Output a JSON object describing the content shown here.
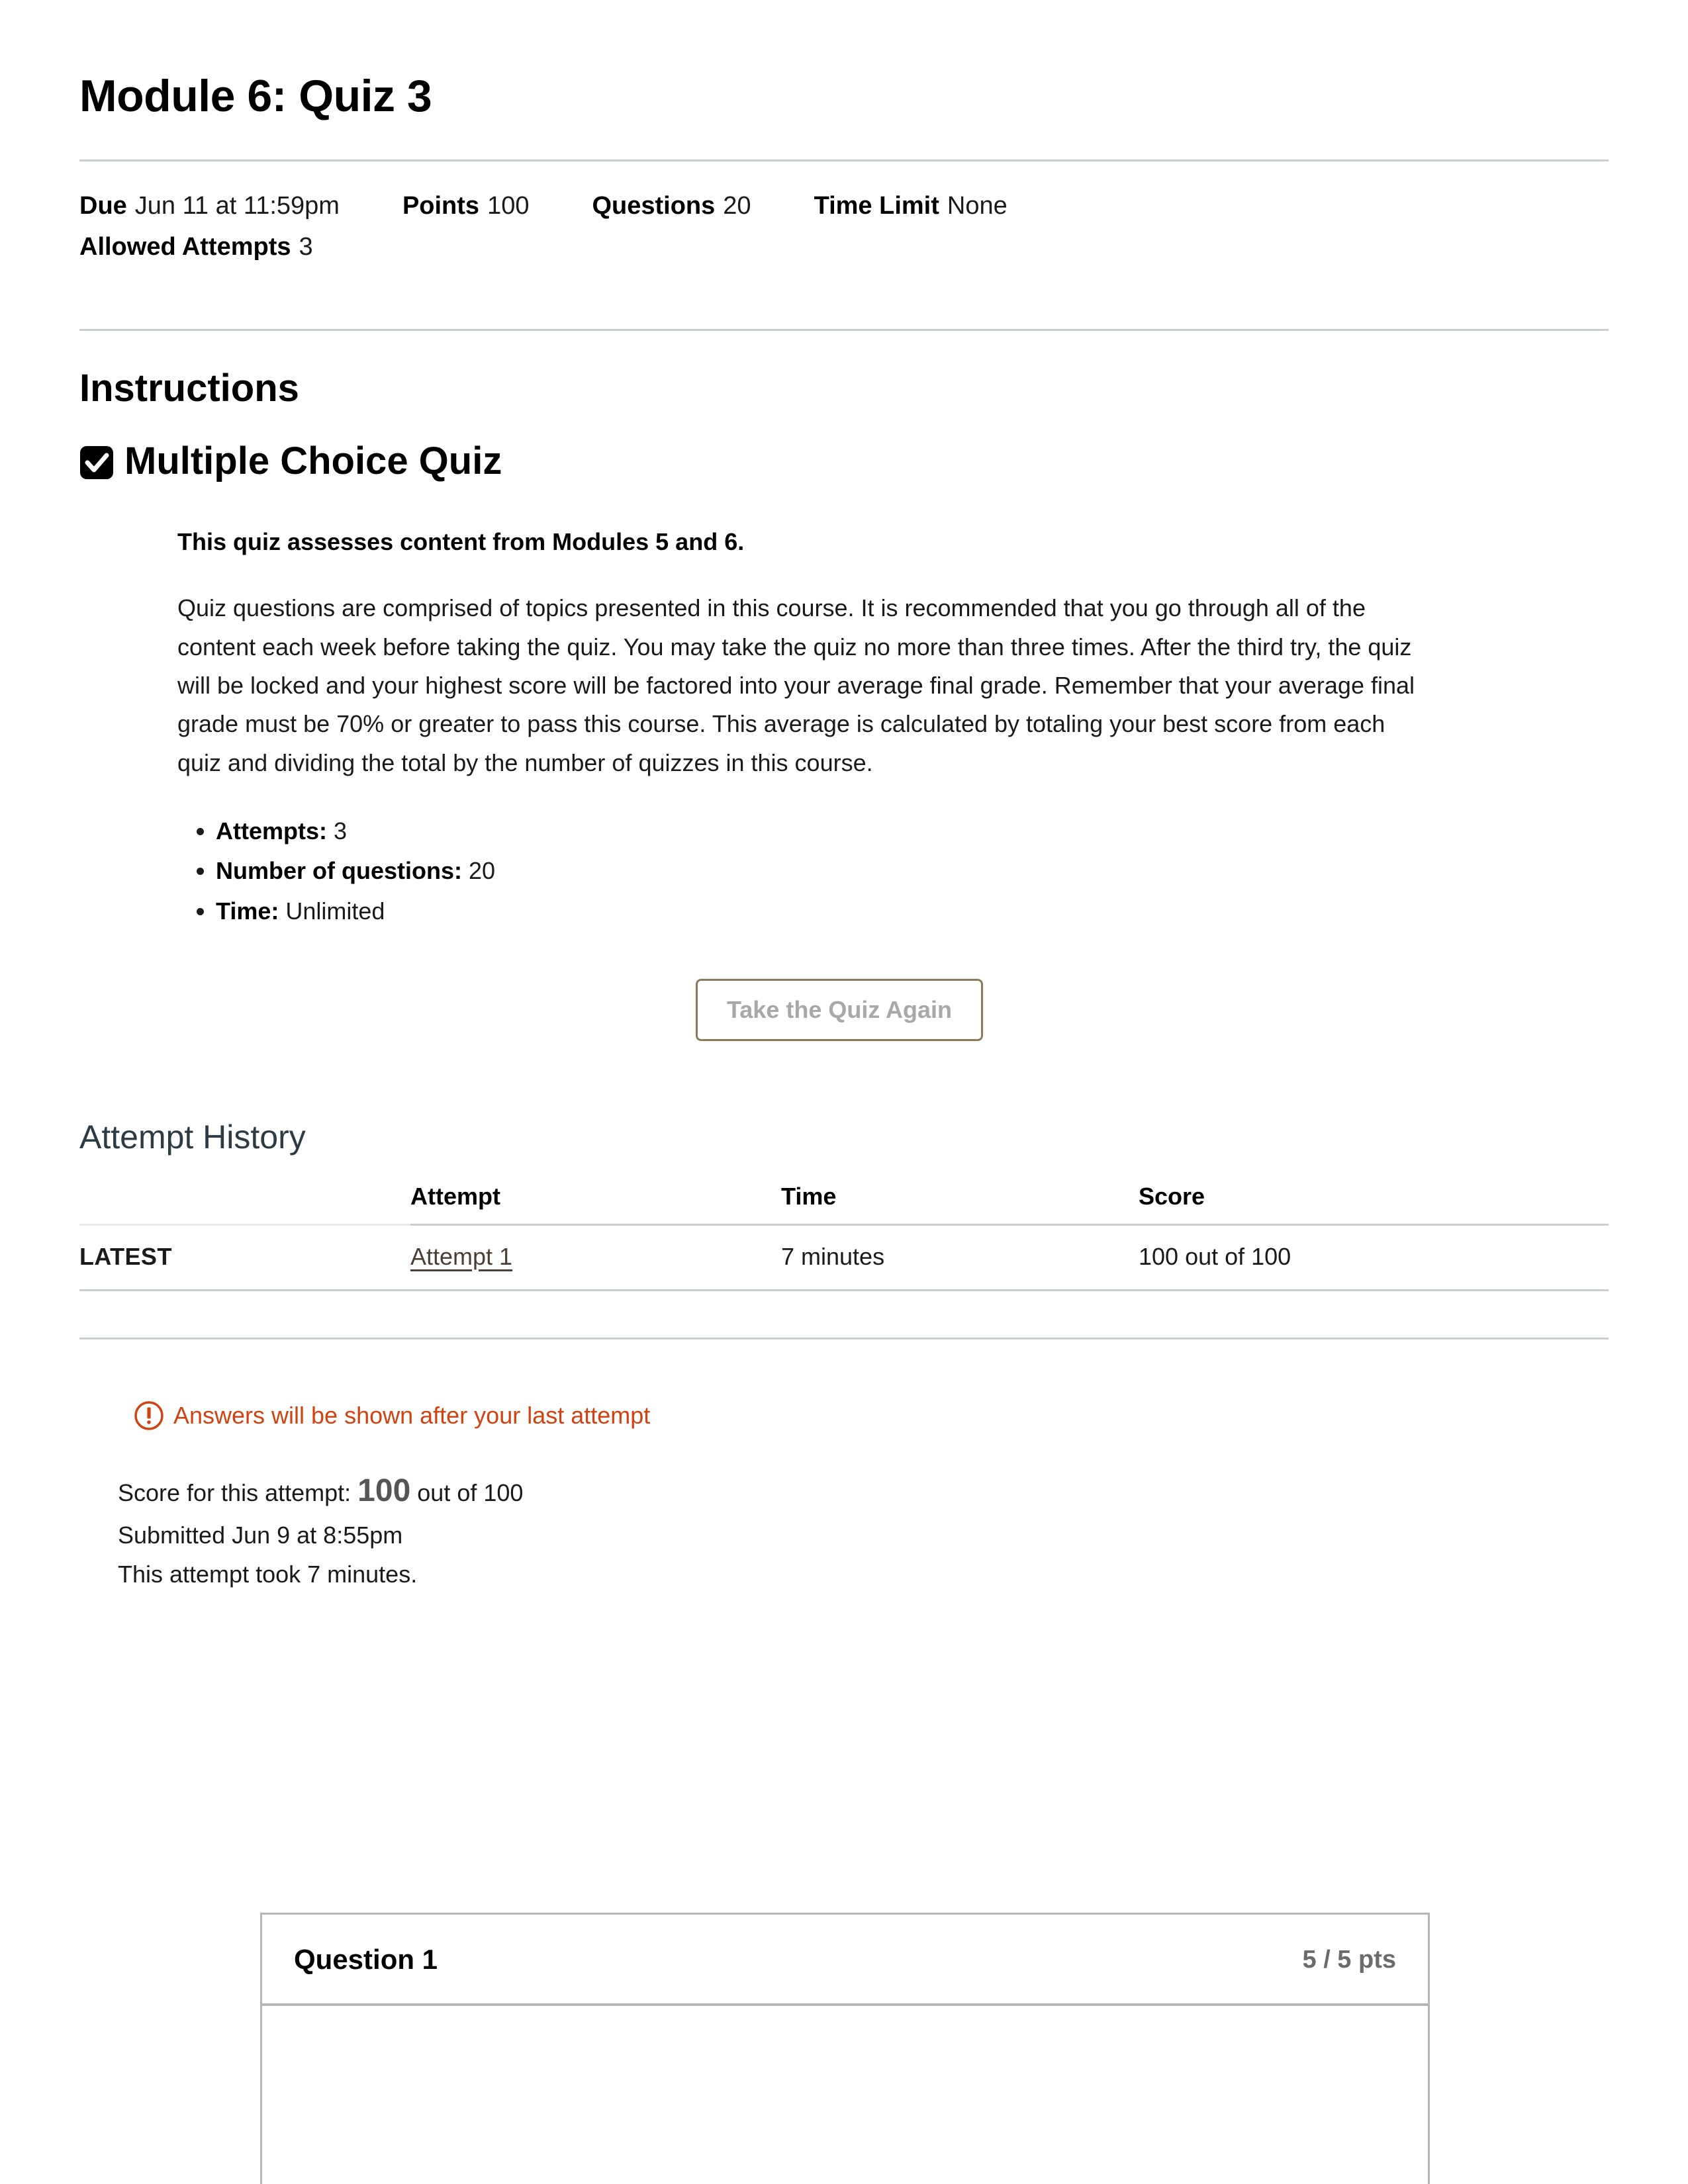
{
  "quiz": {
    "title": "Module 6: Quiz 3"
  },
  "meta": {
    "items": [
      {
        "label": "Due",
        "value": "Jun 11 at 11:59pm"
      },
      {
        "label": "Points",
        "value": "100"
      },
      {
        "label": "Questions",
        "value": "20"
      },
      {
        "label": "Time Limit",
        "value": "None"
      }
    ],
    "attempts_label": "Allowed Attempts",
    "attempts_value": "3"
  },
  "instructions": {
    "heading": "Instructions",
    "subheading": "Multiple Choice Quiz",
    "checkbox_icon": "checkbox-checked-icon",
    "lead": "This quiz assesses content from Modules 5 and 6.",
    "paragraph": "Quiz questions are comprised of topics presented in this course. It is recommended that you go through all of the content each week before taking the quiz. You may take the quiz no more than three times. After the third try, the quiz will be locked and your highest score will be factored into your average final grade. Remember that your average final grade must be 70% or greater to pass this course. This average is calculated by totaling your best score from each quiz and dividing the total by the number of quizzes in this course.",
    "facts": [
      {
        "label": "Attempts:",
        "value": "3"
      },
      {
        "label": "Number of questions:",
        "value": "20"
      },
      {
        "label": "Time:",
        "value": "Unlimited"
      }
    ]
  },
  "actions": {
    "take_quiz_again": "Take the Quiz Again"
  },
  "attempt_history": {
    "heading": "Attempt History",
    "columns": [
      "",
      "Attempt",
      "Time",
      "Score"
    ],
    "rows": [
      {
        "latest": "LATEST",
        "attempt": "Attempt 1",
        "time": "7 minutes",
        "score": "100 out of 100"
      }
    ]
  },
  "notice": {
    "icon": "warning-circle-exclamation-icon",
    "text": "Answers will be shown after your last attempt",
    "color": "#d14210"
  },
  "score_summary": {
    "score_prefix": "Score for this attempt:",
    "score_value": "100",
    "score_suffix": "out of 100",
    "submitted": "Submitted Jun 9 at 8:55pm",
    "duration": "This attempt took 7 minutes."
  },
  "question": {
    "name": "Question 1",
    "points": "5 / 5 pts"
  }
}
